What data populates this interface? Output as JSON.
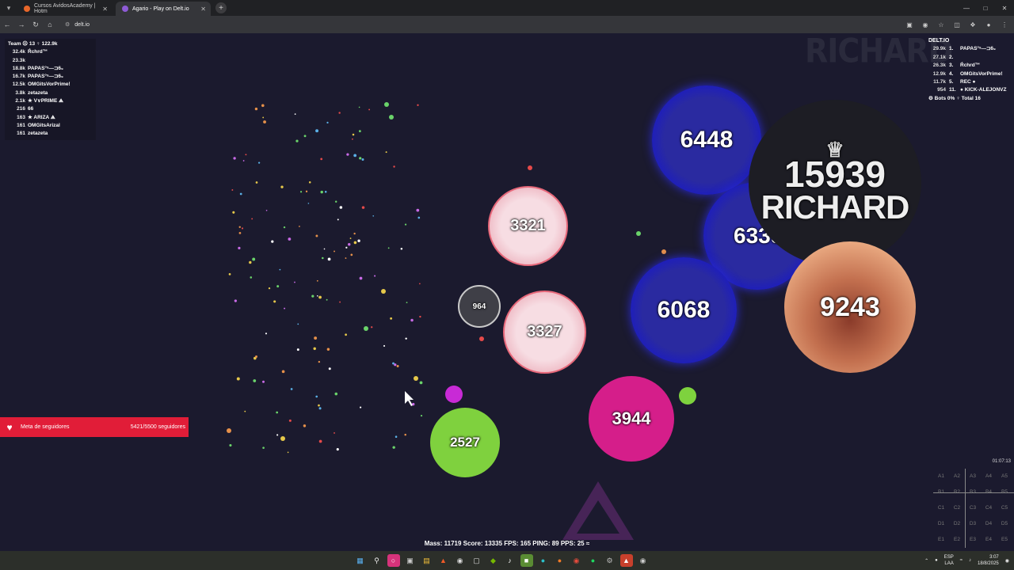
{
  "browser": {
    "tabs": [
      {
        "title": "Cursos AvidosAcademy | Hotm",
        "favicon_color": "#e8672a",
        "active": false
      },
      {
        "title": "Agario - Play on Delt.io",
        "favicon_color": "#8e5bd6",
        "active": true
      }
    ],
    "new_tab_label": "+",
    "url": "delt.io"
  },
  "team_panel": {
    "header": "Team ☹ 13  ♀ 122.9k",
    "members": [
      {
        "mass": "32.4k",
        "name": "Ŕchrd™"
      },
      {
        "mass": "23.3k",
        "name": ""
      },
      {
        "mass": "18.8k",
        "name": "PAPAS°ˢ—⊐6₉"
      },
      {
        "mass": "16.7k",
        "name": "PAPAS°ˢ—⊐6₉"
      },
      {
        "mass": "12.5k",
        "name": "OMGitsVorPrime!"
      },
      {
        "mass": "3.8k",
        "name": "zetazeta"
      },
      {
        "mass": "2.1k",
        "name": "★ V∨PRIME ⟁"
      },
      {
        "mass": "216",
        "name": "66"
      },
      {
        "mass": "163",
        "name": "★ ARIZA ⟁"
      },
      {
        "mass": "161",
        "name": "OMGitsArizal"
      },
      {
        "mass": "161",
        "name": "zetazeta"
      }
    ]
  },
  "leaderboard": {
    "title": "DELT.IO",
    "rows": [
      {
        "mass": "29.9k",
        "rank": "1.",
        "name": "PAPAS°ˢ—⊐6₉"
      },
      {
        "mass": "27.1k",
        "rank": "2.",
        "name": ""
      },
      {
        "mass": "26.3k",
        "rank": "3.",
        "name": "Ŕchrd™"
      },
      {
        "mass": "12.9k",
        "rank": "4.",
        "name": "OMGitsVorPrime!"
      },
      {
        "mass": "11.7k",
        "rank": "5.",
        "name": "REC ●"
      },
      {
        "mass": "954",
        "rank": "11.",
        "name": "● KICK-ALEJONVZ"
      }
    ],
    "footer": "⚙ Bots 0%  ♀ Total 16"
  },
  "watermark": "RICHARD",
  "cells": [
    {
      "mass": "6448",
      "color": "#1f1fa8"
    },
    {
      "mass": "6339",
      "color": "#1f1fa8"
    },
    {
      "mass": "6068",
      "color": "#1f1fa8"
    },
    {
      "mass": "15939",
      "name": "RICHARD",
      "color": "#1e1e27"
    },
    {
      "mass": "9243",
      "color": "#b86a4a"
    },
    {
      "mass": "3321",
      "color": "#f1c5cd"
    },
    {
      "mass": "3327",
      "color": "#f1c5cd"
    },
    {
      "mass": "964",
      "color": "#4a4a52"
    },
    {
      "mass": "3944",
      "color": "#d61e8c"
    },
    {
      "mass": "2527",
      "color": "#7ed23e"
    }
  ],
  "follower_goal": {
    "label": "Meta de seguidores",
    "value": "5421/5500 seguidores"
  },
  "timer": "01:07:13",
  "minimap_labels": [
    "A1",
    "A2",
    "A3",
    "A4",
    "A5",
    "B1",
    "B2",
    "B3",
    "B4",
    "B5",
    "C1",
    "C2",
    "C3",
    "C4",
    "C5",
    "D1",
    "D2",
    "D3",
    "D4",
    "D5",
    "E1",
    "E2",
    "E3",
    "E4",
    "E5"
  ],
  "stats": "Mass: 11719  Score: 13335  FPS: 165  PING: 89  PPS: 25",
  "taskbar": {
    "lang": "ESP",
    "lang2": "LAA",
    "time": "3:07",
    "date": "18/8/2025"
  }
}
